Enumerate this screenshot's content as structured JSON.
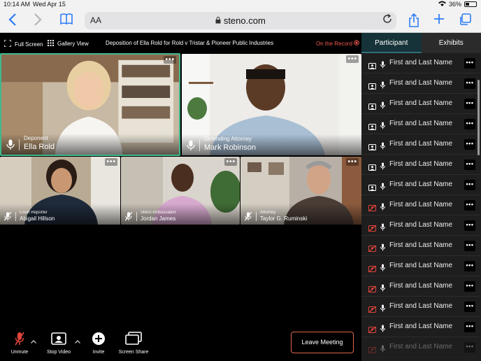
{
  "status_bar": {
    "time": "10:14 AM",
    "date": "Wed Apr 15",
    "battery": "36%"
  },
  "browser": {
    "text_size": "AA",
    "url": "steno.com"
  },
  "meeting": {
    "full_screen": "Full Screen",
    "gallery_view": "Gallery View",
    "title": "Deposition of Ella Rold for Rold v Tristar & Pioneer Public Industries",
    "record_status": "On the Record",
    "tiles": [
      {
        "role": "Deponent",
        "name": "Ella Rold"
      },
      {
        "role": "Defending Attorney",
        "name": "Mark Robinson"
      },
      {
        "role": "Court Reporter",
        "name": "Abigail Hillson"
      },
      {
        "role": "Steno Ambassador",
        "name": "Jordan James"
      },
      {
        "role": "Attorney",
        "name": "Taylor G. Ruminski"
      }
    ],
    "more": "•••",
    "controls": {
      "unmute": "Unmute",
      "stop_video": "Stop Video",
      "invite": "Invite",
      "screen_share": "Screen Share",
      "leave": "Leave Meeting"
    }
  },
  "sidebar": {
    "tabs": [
      "Participant",
      "Exhibits"
    ],
    "participants": [
      {
        "name": "First and Last Name",
        "video": "on"
      },
      {
        "name": "First and Last Name",
        "video": "on"
      },
      {
        "name": "First and Last Name",
        "video": "on"
      },
      {
        "name": "First and Last Name",
        "video": "on"
      },
      {
        "name": "First and Last Name",
        "video": "on"
      },
      {
        "name": "First and Last Name",
        "video": "on"
      },
      {
        "name": "First and Last Name",
        "video": "on"
      },
      {
        "name": "First and Last Name",
        "video": "off"
      },
      {
        "name": "First and Last Name",
        "video": "off"
      },
      {
        "name": "First and Last Name",
        "video": "off"
      },
      {
        "name": "First and Last Name",
        "video": "off"
      },
      {
        "name": "First and Last Name",
        "video": "off"
      },
      {
        "name": "First and Last Name",
        "video": "off"
      },
      {
        "name": "First and Last Name",
        "video": "off"
      },
      {
        "name": "First and Last Name",
        "video": "off"
      }
    ],
    "more": "•••"
  },
  "colors": {
    "accent": "#2e7cf6",
    "record": "#f05a4f",
    "muted": "#e0443a",
    "leave_border": "#e0664d",
    "active_tab": "#153338"
  }
}
